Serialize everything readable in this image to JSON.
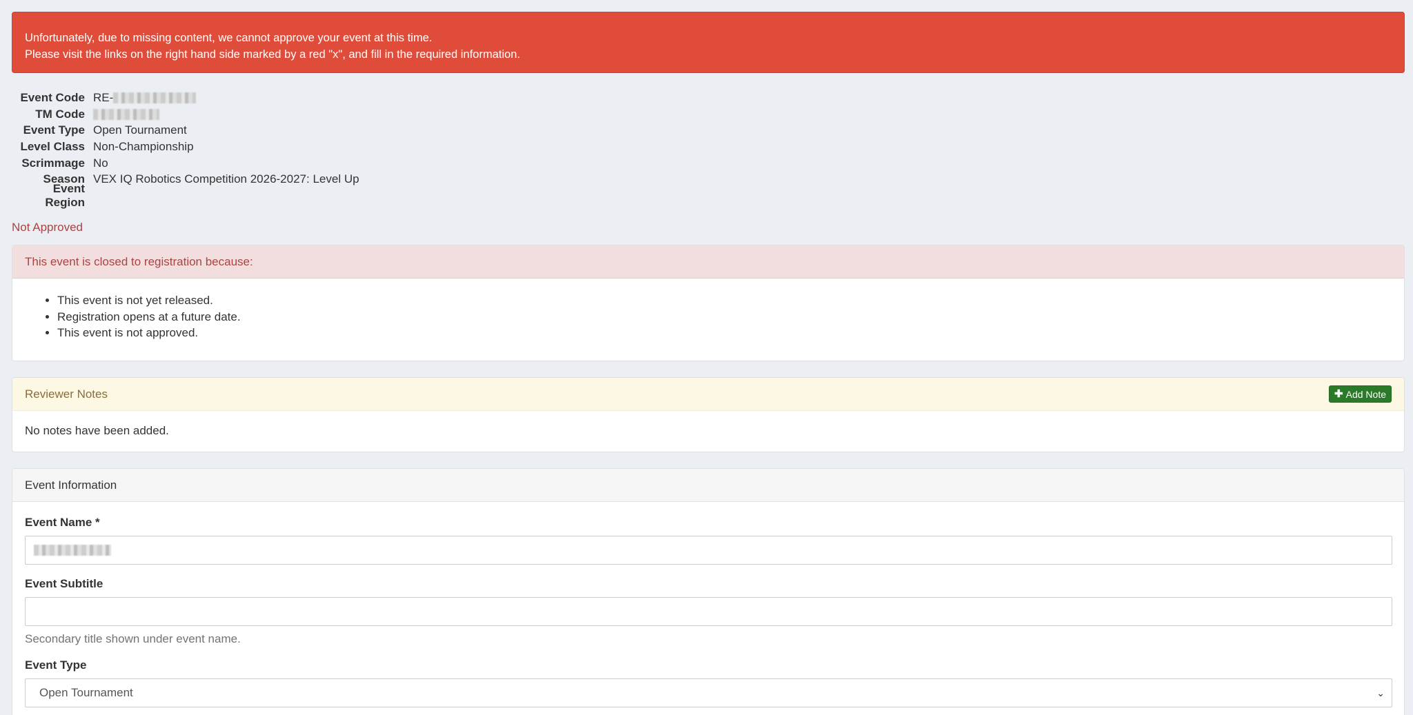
{
  "alert": {
    "line1": "Unfortunately, due to missing content, we cannot approve your event at this time.",
    "line2": "Please visit the links on the right hand side marked by a red \"x\", and fill in the required information."
  },
  "event_info": {
    "event_code_label": "Event Code",
    "event_code_prefix": "RE-",
    "tm_code_label": "TM Code",
    "event_type_label": "Event Type",
    "event_type_value": "Open Tournament",
    "level_class_label": "Level Class",
    "level_class_value": "Non-Championship",
    "scrimmage_label": "Scrimmage",
    "scrimmage_value": "No",
    "season_label": "Season",
    "season_value": "VEX IQ Robotics Competition 2026-2027: Level Up",
    "event_region_label": "Event Region"
  },
  "status": "Not Approved",
  "closed_panel": {
    "heading": "This event is closed to registration because:",
    "reasons": [
      "This event is not yet released.",
      "Registration opens at a future date.",
      "This event is not approved."
    ]
  },
  "reviewer_notes": {
    "heading": "Reviewer Notes",
    "add_button_label": "Add Note",
    "empty_text": "No notes have been added."
  },
  "event_form": {
    "heading": "Event Information",
    "name_label": "Event Name *",
    "subtitle_label": "Event Subtitle",
    "subtitle_value": "",
    "subtitle_help": "Secondary title shown under event name.",
    "type_label": "Event Type",
    "type_selected": "Open Tournament"
  },
  "colors": {
    "alert_bg": "#e04c3a",
    "danger_text": "#a94442",
    "add_button_bg": "#2a7a2a"
  }
}
